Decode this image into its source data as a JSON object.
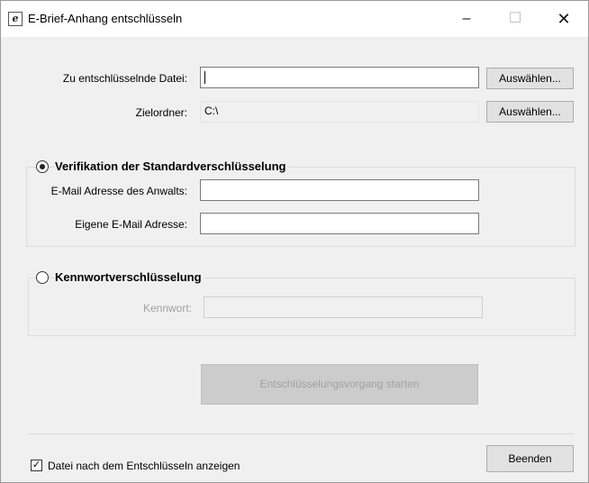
{
  "window": {
    "title": "E-Brief-Anhang entschlüsseln",
    "app_icon_letter": "e",
    "controls": {
      "minimize": "–",
      "maximize": "☐",
      "close": "✕"
    }
  },
  "file_section": {
    "file_label": "Zu entschlüsselnde Datei:",
    "file_value": "",
    "browse_file_label": "Auswählen...",
    "folder_label": "Zielordner:",
    "folder_value": "C:\\",
    "browse_folder_label": "Auswählen..."
  },
  "standard_verification": {
    "radio_label": "Verifikation der Standardverschlüsselung",
    "selected": true,
    "lawyer_email_label": "E-Mail Adresse des Anwalts:",
    "lawyer_email_value": "",
    "own_email_label": "Eigene E-Mail Adresse:",
    "own_email_value": ""
  },
  "password_encryption": {
    "radio_label": "Kennwortverschlüsselung",
    "selected": false,
    "password_label": "Kennwort:",
    "password_value": ""
  },
  "start_button_label": "Entschlüsselungsvorgang starten",
  "footer": {
    "show_file_checkbox_label": "Datei nach dem Entschlüsseln anzeigen",
    "show_file_checked": true,
    "checkmark": "✓",
    "exit_button_label": "Beenden"
  },
  "colors": {
    "window_bg": "#f0f0f0",
    "titlebar_bg": "#ffffff",
    "disabled_text": "#a0a0a0",
    "button_face": "#e1e1e1",
    "button_disabled": "#cccccc"
  }
}
